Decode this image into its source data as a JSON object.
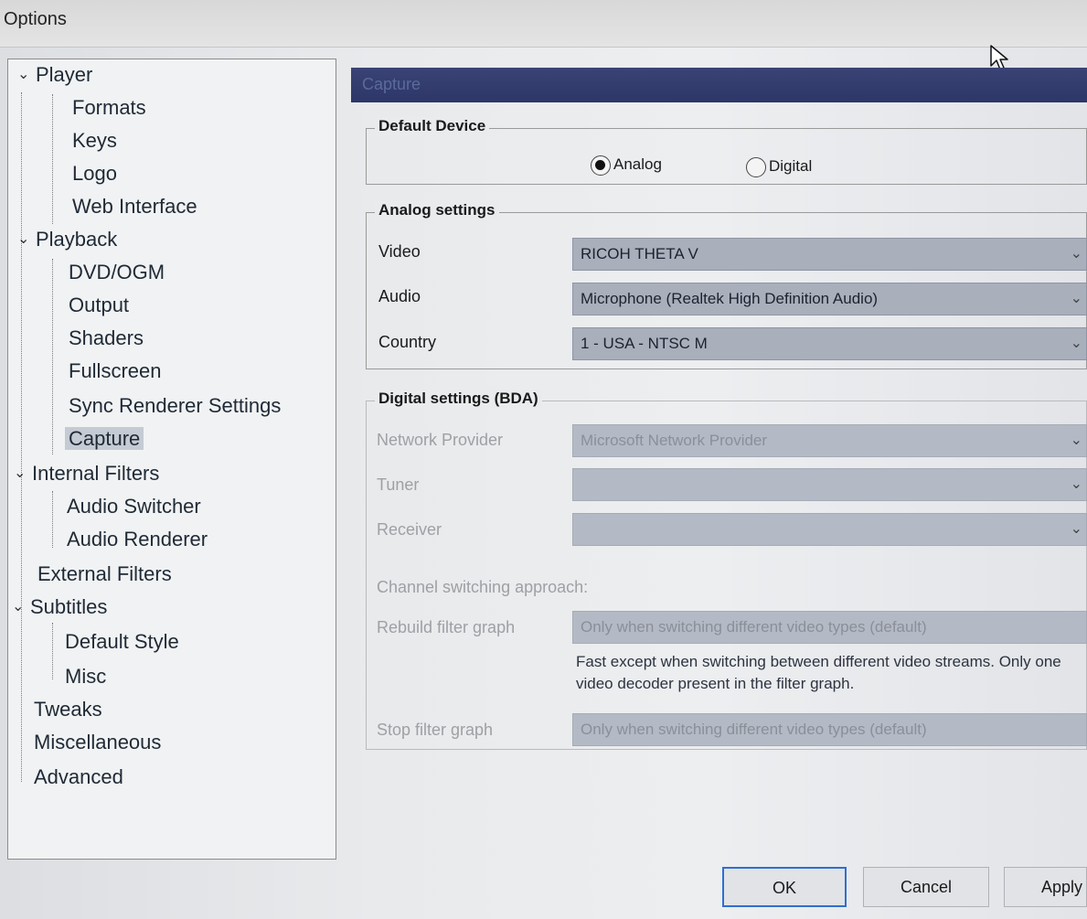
{
  "window": {
    "title": "Options"
  },
  "tree": {
    "items": [
      {
        "label": "Player",
        "level": 0,
        "expandable": true
      },
      {
        "label": "Formats",
        "level": 1
      },
      {
        "label": "Keys",
        "level": 1
      },
      {
        "label": "Logo",
        "level": 1
      },
      {
        "label": "Web Interface",
        "level": 1
      },
      {
        "label": "Playback",
        "level": 0,
        "expandable": true
      },
      {
        "label": "DVD/OGM",
        "level": 1
      },
      {
        "label": "Output",
        "level": 1
      },
      {
        "label": "Shaders",
        "level": 1
      },
      {
        "label": "Fullscreen",
        "level": 1
      },
      {
        "label": "Sync Renderer Settings",
        "level": 1
      },
      {
        "label": "Capture",
        "level": 1,
        "selected": true
      },
      {
        "label": "Internal Filters",
        "level": 0,
        "expandable": true
      },
      {
        "label": "Audio Switcher",
        "level": 1
      },
      {
        "label": "Audio Renderer",
        "level": 1
      },
      {
        "label": "External Filters",
        "level": 0
      },
      {
        "label": "Subtitles",
        "level": 0,
        "expandable": true
      },
      {
        "label": "Default Style",
        "level": 1
      },
      {
        "label": "Misc",
        "level": 1
      },
      {
        "label": "Tweaks",
        "level": 0
      },
      {
        "label": "Miscellaneous",
        "level": 0
      },
      {
        "label": "Advanced",
        "level": 0
      }
    ]
  },
  "page": {
    "header": "Capture",
    "default_device": {
      "legend": "Default Device",
      "options": [
        "Analog",
        "Digital"
      ],
      "selected": "Analog"
    },
    "analog": {
      "legend": "Analog settings",
      "video_label": "Video",
      "video_value": "RICOH THETA V",
      "audio_label": "Audio",
      "audio_value": "Microphone (Realtek High Definition Audio)",
      "country_label": "Country",
      "country_value": "1 - USA - NTSC M"
    },
    "digital": {
      "legend": "Digital settings (BDA)",
      "network_provider_label": "Network Provider",
      "network_provider_value": "Microsoft Network Provider",
      "tuner_label": "Tuner",
      "tuner_value": "",
      "receiver_label": "Receiver",
      "receiver_value": "",
      "channel_switching_label": "Channel switching approach:",
      "rebuild_label": "Rebuild filter graph",
      "rebuild_value": "Only when switching different video types (default)",
      "rebuild_note": "Fast except when switching between different video streams. Only one video decoder present in the filter graph.",
      "stop_label": "Stop filter graph",
      "stop_value": "Only when switching different video types (default)"
    }
  },
  "buttons": {
    "ok": "OK",
    "cancel": "Cancel",
    "apply": "Apply"
  },
  "colors": {
    "header_bar": "#2d3668",
    "combo_bg": "#a9afbb",
    "selection": "#c5cbd4",
    "default_button_border": "#2f6fd0"
  },
  "icons": {
    "expand": "chevron-down-icon",
    "combo_arrow": "chevron-down-icon",
    "cursor": "mouse-pointer-icon"
  }
}
